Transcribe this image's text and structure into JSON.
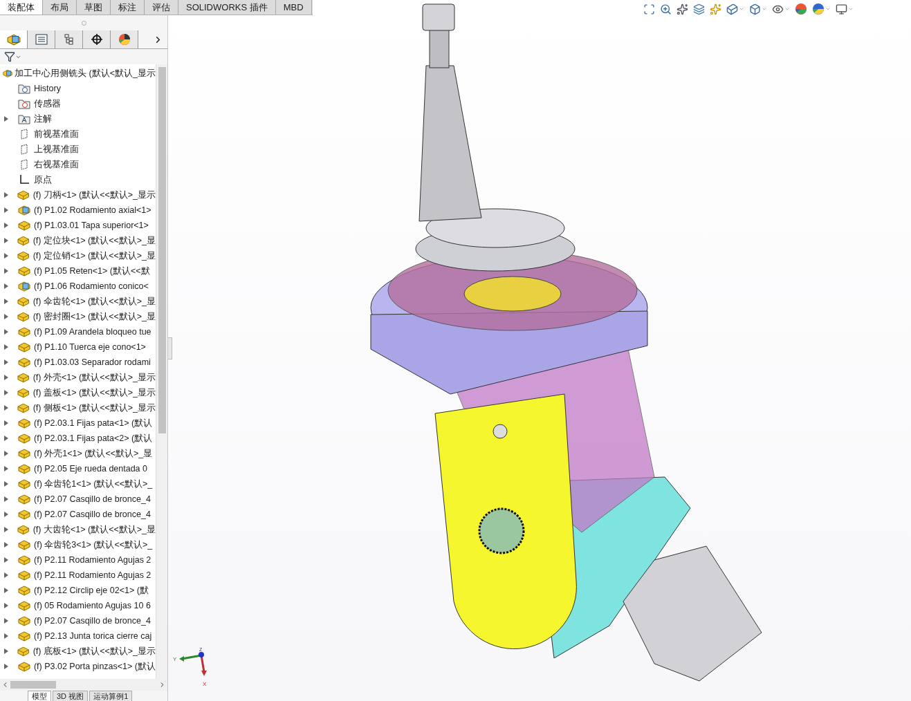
{
  "command_tabs": [
    {
      "label": "装配体",
      "selected": true
    },
    {
      "label": "布局",
      "selected": false
    },
    {
      "label": "草图",
      "selected": false
    },
    {
      "label": "标注",
      "selected": false
    },
    {
      "label": "评估",
      "selected": false
    },
    {
      "label": "SOLIDWORKS 插件",
      "selected": false
    },
    {
      "label": "MBD",
      "selected": false
    }
  ],
  "panel_tabs": [
    {
      "kind": "feature-tree",
      "selected": true
    },
    {
      "kind": "property",
      "selected": false
    },
    {
      "kind": "configuration",
      "selected": false
    },
    {
      "kind": "dimxpert",
      "selected": false
    },
    {
      "kind": "display",
      "selected": false
    }
  ],
  "tree": {
    "label": "加工中心用侧铣头 (默认<默认_显示",
    "children": [
      {
        "kind": "history",
        "label": "History",
        "expandable": false
      },
      {
        "kind": "sensor",
        "label": "传感器",
        "expandable": false
      },
      {
        "kind": "annotation",
        "label": "注解",
        "expandable": true
      },
      {
        "kind": "plane",
        "label": "前视基准面",
        "expandable": false
      },
      {
        "kind": "plane",
        "label": "上视基准面",
        "expandable": false
      },
      {
        "kind": "plane",
        "label": "右视基准面",
        "expandable": false
      },
      {
        "kind": "origin",
        "label": "原点",
        "expandable": false
      },
      {
        "kind": "part",
        "label": "(f) 刀柄<1> (默认<<默认>_显示",
        "expandable": true
      },
      {
        "kind": "assembly",
        "label": "(f) P1.02 Rodamiento axial<1>",
        "expandable": true
      },
      {
        "kind": "part",
        "label": "(f) P1.03.01 Tapa superior<1>",
        "expandable": true
      },
      {
        "kind": "part",
        "label": "(f) 定位块<1> (默认<<默认>_显",
        "expandable": true
      },
      {
        "kind": "part",
        "label": "(f) 定位销<1> (默认<<默认>_显",
        "expandable": true
      },
      {
        "kind": "part",
        "label": "(f) P1.05 Reten<1> (默认<<默",
        "expandable": true
      },
      {
        "kind": "assembly",
        "label": "(f) P1.06 Rodamiento conico<",
        "expandable": true
      },
      {
        "kind": "part",
        "label": "(f) 伞齿轮<1> (默认<<默认>_显",
        "expandable": true
      },
      {
        "kind": "part",
        "label": "(f) 密封圈<1> (默认<<默认>_显",
        "expandable": true
      },
      {
        "kind": "part",
        "label": "(f) P1.09 Arandela bloqueo tue",
        "expandable": true
      },
      {
        "kind": "part",
        "label": "(f) P1.10 Tuerca eje cono<1>",
        "expandable": true
      },
      {
        "kind": "part",
        "label": "(f) P1.03.03 Separador rodami",
        "expandable": true
      },
      {
        "kind": "part",
        "label": "(f) 外壳<1> (默认<<默认>_显示",
        "expandable": true
      },
      {
        "kind": "part",
        "label": "(f) 盖板<1> (默认<<默认>_显示",
        "expandable": true
      },
      {
        "kind": "part",
        "label": "(f) 侧板<1> (默认<<默认>_显示",
        "expandable": true
      },
      {
        "kind": "part",
        "label": "(f) P2.03.1 Fijas pata<1> (默认",
        "expandable": true
      },
      {
        "kind": "part",
        "label": "(f) P2.03.1 Fijas pata<2> (默认",
        "expandable": true
      },
      {
        "kind": "part",
        "label": "(f) 外壳1<1> (默认<<默认>_显",
        "expandable": true
      },
      {
        "kind": "part",
        "label": "(f) P2.05 Eje rueda dentada 0",
        "expandable": true
      },
      {
        "kind": "part",
        "label": "(f) 伞齿轮1<1> (默认<<默认>_",
        "expandable": true
      },
      {
        "kind": "part",
        "label": "(f) P2.07 Casqillo de bronce_4",
        "expandable": true
      },
      {
        "kind": "part",
        "label": "(f) P2.07 Casqillo de bronce_4",
        "expandable": true
      },
      {
        "kind": "part",
        "label": "(f) 大齿轮<1> (默认<<默认>_显",
        "expandable": true
      },
      {
        "kind": "part",
        "label": "(f) 伞齿轮3<1> (默认<<默认>_",
        "expandable": true
      },
      {
        "kind": "part",
        "label": "(f) P2.11 Rodamiento Agujas 2",
        "expandable": true
      },
      {
        "kind": "part",
        "label": "(f) P2.11 Rodamiento Agujas 2",
        "expandable": true
      },
      {
        "kind": "part",
        "label": "(f) P2.12 Circlip eje 02<1> (默",
        "expandable": true
      },
      {
        "kind": "part",
        "label": "(f) 05 Rodamiento Agujas 10 6",
        "expandable": true
      },
      {
        "kind": "part",
        "label": "(f) P2.07 Casqillo de bronce_4",
        "expandable": true
      },
      {
        "kind": "part",
        "label": "(f) P2.13 Junta torica cierre caj",
        "expandable": true
      },
      {
        "kind": "part",
        "label": "(f) 底板<1> (默认<<默认>_显示",
        "expandable": true
      },
      {
        "kind": "part",
        "label": "(f) P3.02 Porta pinzas<1> (默认",
        "expandable": true
      }
    ]
  },
  "bottom_tabs": [
    {
      "label": "模型",
      "selected": true
    },
    {
      "label": "3D 视图",
      "selected": false
    },
    {
      "label": "运动算例1",
      "selected": false
    }
  ],
  "triad": {
    "x": "X",
    "y": "Y",
    "z": "Z"
  }
}
